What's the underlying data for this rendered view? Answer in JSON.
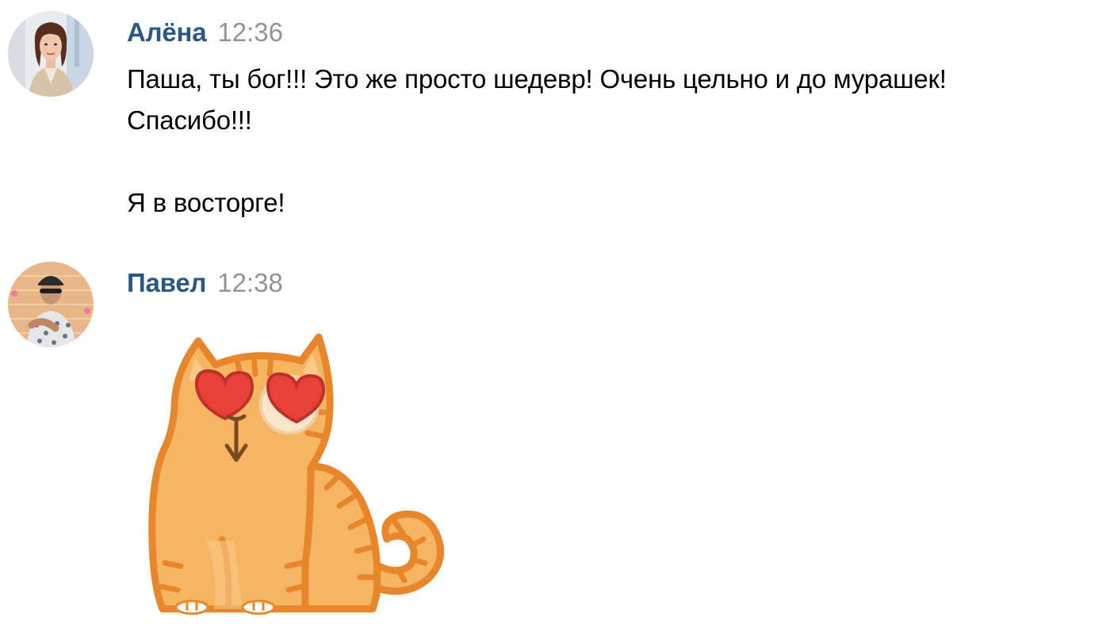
{
  "messages": [
    {
      "author": "Алёна",
      "time": "12:36",
      "text_lines": [
        "Паша, ты бог!!! Это же просто шедевр! Очень цельно и до мурашек!",
        "Спасибо!!!",
        "Я в восторге!"
      ]
    },
    {
      "author": "Павел",
      "time": "12:38",
      "sticker": "heart-eyes-cat-sticker"
    }
  ],
  "colors": {
    "author": "#2a5885",
    "time": "#939393",
    "text": "#000000",
    "cat_body": "#f6b560",
    "cat_outline": "#e8862b",
    "heart": "#e8413a"
  }
}
